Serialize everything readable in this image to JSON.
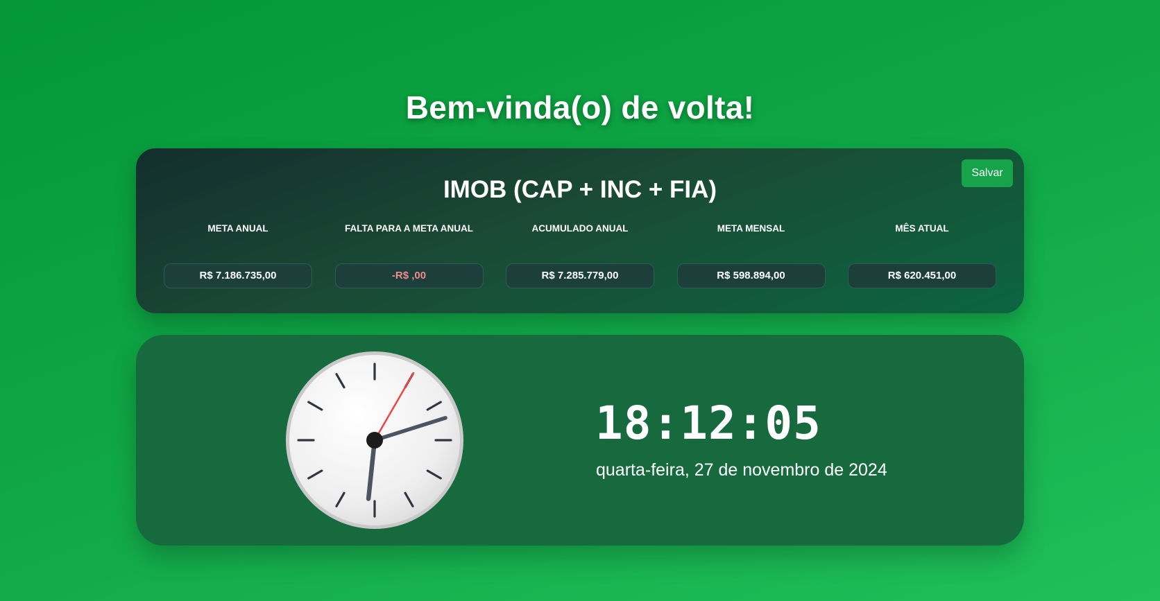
{
  "header": {
    "welcome": "Bem-vinda(o) de volta!"
  },
  "goals": {
    "title": "IMOB (CAP + INC + FIA)",
    "save_label": "Salvar",
    "metrics": [
      {
        "label": "META ANUAL",
        "value": "R$ 7.186.735,00"
      },
      {
        "label": "FALTA PARA A META ANUAL",
        "value": "-R$ ,00"
      },
      {
        "label": "ACUMULADO ANUAL",
        "value": "R$ 7.285.779,00"
      },
      {
        "label": "META MENSAL",
        "value": "R$ 598.894,00"
      },
      {
        "label": "MÊS ATUAL",
        "value": "R$ 620.451,00"
      }
    ]
  },
  "clock": {
    "time": "18:12:05",
    "date": "quarta-feira, 27 de novembro de 2024",
    "colors": {
      "second_hand": "#ef4444",
      "hands": "#4b5563",
      "ticks": "#2f3640"
    }
  },
  "colors": {
    "accent": "#16a34a",
    "negative_value": "#f28b8b"
  }
}
